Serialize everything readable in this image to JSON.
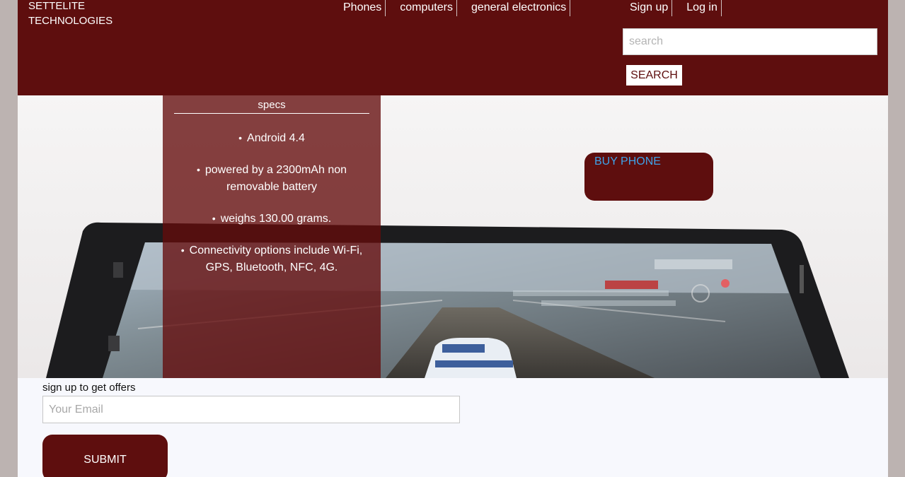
{
  "header": {
    "logo_line1": "SETTELITE",
    "logo_line2": "TECHNOLOGIES",
    "nav": {
      "phones": "Phones",
      "computers": "computers",
      "general_electronics": "general electronics"
    },
    "auth": {
      "signup": "Sign up",
      "login": "Log in"
    },
    "search": {
      "placeholder": "search",
      "button": "SEARCH"
    }
  },
  "hero": {
    "specs_title": "specs",
    "specs": [
      "Android 4.4",
      "powered by a 2300mAh non removable battery",
      "weighs 130.00 grams.",
      "Connectivity options include Wi-Fi, GPS, Bluetooth, NFC, 4G."
    ],
    "buy_button": "BUY PHONE"
  },
  "signup": {
    "label": "sign up to get offers",
    "email_placeholder": "Your Email",
    "submit": "SUBMIT"
  },
  "colors": {
    "brand": "#5e0e0e",
    "link": "#3fa2e8",
    "page_bg": "#f7f8fd",
    "outer_bg": "#bcb3b1"
  }
}
